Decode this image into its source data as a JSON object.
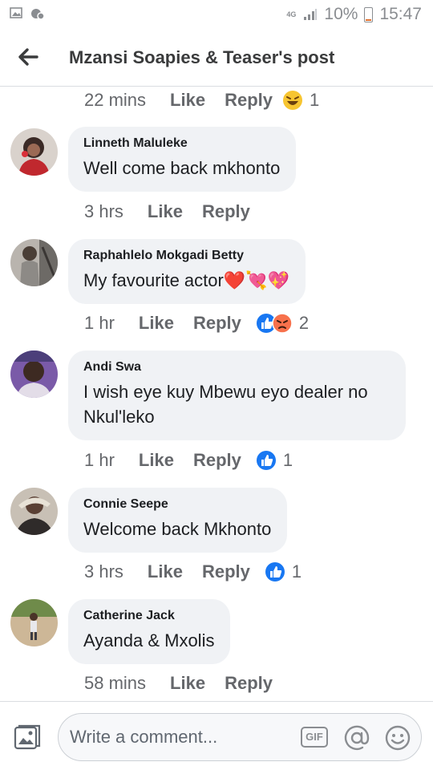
{
  "status_bar": {
    "network": "4G",
    "battery": "10%",
    "time": "15:47"
  },
  "header": {
    "title": "Mzansi Soapies & Teaser's post"
  },
  "top_actions": {
    "time": "22 mins",
    "like": "Like",
    "reply": "Reply",
    "reaction_count": "1"
  },
  "comments": [
    {
      "author": "Linneth Maluleke",
      "text": "Well come back mkhonto",
      "time": "3 hrs",
      "like": "Like",
      "reply": "Reply"
    },
    {
      "author": "Raphahlelo Mokgadi Betty",
      "text": "My favourite actor",
      "emojis": "❤️💘💖",
      "time": "1 hr",
      "like": "Like",
      "reply": "Reply",
      "reaction_count": "2"
    },
    {
      "author": "Andi Swa",
      "text": "I wish eye kuy Mbewu eyo dealer no Nkul'leko",
      "time": "1 hr",
      "like": "Like",
      "reply": "Reply",
      "reaction_count": "1"
    },
    {
      "author": "Connie Seepe",
      "text": "Welcome back Mkhonto",
      "time": "3 hrs",
      "like": "Like",
      "reply": "Reply",
      "reaction_count": "1"
    },
    {
      "author": "Catherine Jack",
      "text": "Ayanda & Mxolis",
      "time": "58 mins",
      "like": "Like",
      "reply": "Reply"
    }
  ],
  "composer": {
    "placeholder": "Write a comment...",
    "gif_label": "GIF"
  },
  "colors": {
    "like_blue": "#1877f2",
    "angry_orange": "#f7714c",
    "haha_yellow": "#f7c531"
  }
}
